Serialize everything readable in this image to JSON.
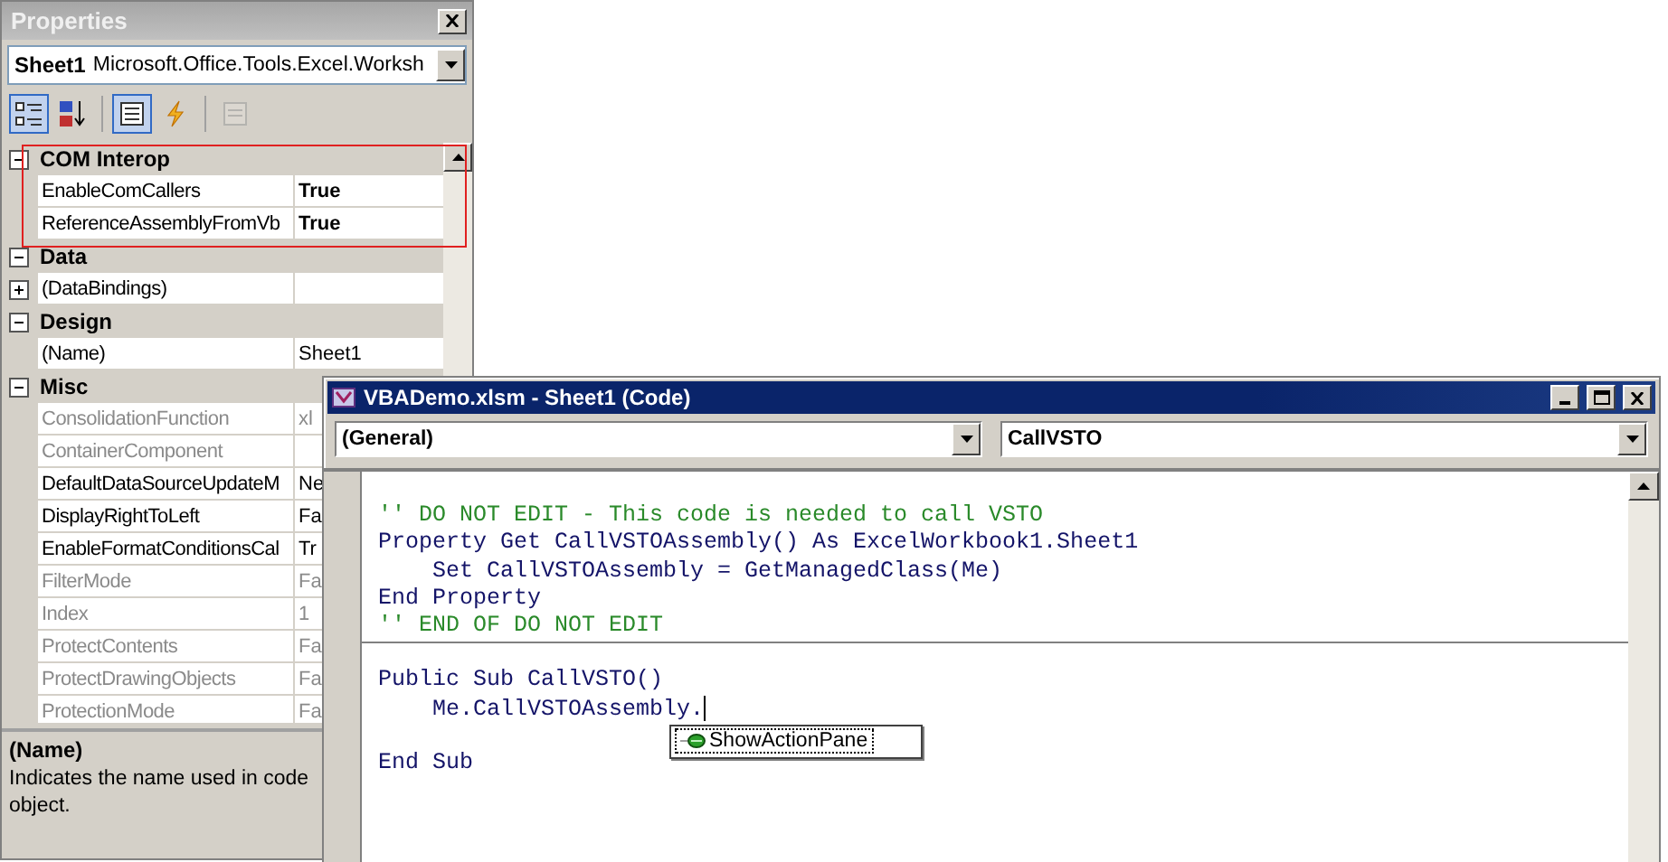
{
  "properties_panel": {
    "title": "Properties",
    "object_selector": {
      "name": "Sheet1",
      "type": "Microsoft.Office.Tools.Excel.Worksh"
    },
    "toolbar": [
      {
        "kind": "categorized",
        "selected": true,
        "disabled": false
      },
      {
        "kind": "alphabetical",
        "selected": false,
        "disabled": false
      },
      {
        "kind": "properties",
        "selected": true,
        "disabled": false
      },
      {
        "kind": "events",
        "selected": false,
        "disabled": false
      },
      {
        "kind": "property_pages",
        "selected": false,
        "disabled": true
      }
    ],
    "categories": [
      {
        "name": "COM Interop",
        "expanded": true,
        "highlighted": true,
        "rows": [
          {
            "name": "EnableComCallers",
            "value": "True",
            "disabled": false,
            "modified": true
          },
          {
            "name": "ReferenceAssemblyFromVb",
            "value": "True",
            "disabled": false,
            "modified": true
          }
        ]
      },
      {
        "name": "Data",
        "expanded": true,
        "highlighted": false,
        "rows": [
          {
            "name": "(DataBindings)",
            "disabled": false,
            "expanded": false
          }
        ]
      },
      {
        "name": "Design",
        "expanded": true,
        "highlighted": false,
        "rows": [
          {
            "name": "(Name)",
            "value": "Sheet1",
            "disabled": false,
            "modified": false
          }
        ]
      },
      {
        "name": "Misc",
        "expanded": true,
        "highlighted": false,
        "rows": [
          {
            "name": "ConsolidationFunction",
            "value": "xl",
            "disabled": true,
            "modified": false
          },
          {
            "name": "ContainerComponent",
            "disabled": true
          },
          {
            "name": "DefaultDataSourceUpdateM",
            "value": "Ne",
            "disabled": false,
            "modified": false
          },
          {
            "name": "DisplayRightToLeft",
            "value": "Fa",
            "disabled": false,
            "modified": false
          },
          {
            "name": "EnableFormatConditionsCal",
            "value": "Tr",
            "disabled": false,
            "modified": false
          },
          {
            "name": "FilterMode",
            "value": "Fa",
            "disabled": true,
            "modified": false
          },
          {
            "name": "Index",
            "value": "1",
            "disabled": true,
            "modified": false
          },
          {
            "name": "ProtectContents",
            "value": "Fa",
            "disabled": true,
            "modified": false
          },
          {
            "name": "ProtectDrawingObjects",
            "value": "Fa",
            "disabled": true,
            "modified": false
          },
          {
            "name": "ProtectionMode",
            "value": "Fa",
            "disabled": true,
            "modified": false
          }
        ]
      }
    ],
    "description": {
      "title": "(Name)",
      "text": "Indicates the name used in code object."
    }
  },
  "code_window": {
    "title": "VBADemo.xlsm - Sheet1 (Code)",
    "object_combo": "(General)",
    "procedure_combo": "CallVSTO",
    "procedures": [
      {
        "lines": [
          {
            "kind": "comment",
            "text": "'' DO NOT EDIT - This code is needed to call VSTO"
          },
          {
            "kind": "code",
            "text": "Property Get CallVSTOAssembly() As ExcelWorkbook1.Sheet1"
          },
          {
            "kind": "code",
            "text": "    Set CallVSTOAssembly = GetManagedClass(Me)"
          },
          {
            "kind": "code",
            "text": "End Property"
          },
          {
            "kind": "comment",
            "text": "'' END OF DO NOT EDIT"
          }
        ]
      },
      {
        "lines": [
          {
            "kind": "code",
            "text": "Public Sub CallVSTO()"
          },
          {
            "kind": "code",
            "text": "    Me.CallVSTOAssembly.",
            "caret": true,
            "completion": [
              {
                "label": "ShowActionPane",
                "selected": true
              }
            ]
          },
          {
            "kind": "blank"
          },
          {
            "kind": "code",
            "text": "End Sub"
          }
        ]
      }
    ]
  }
}
